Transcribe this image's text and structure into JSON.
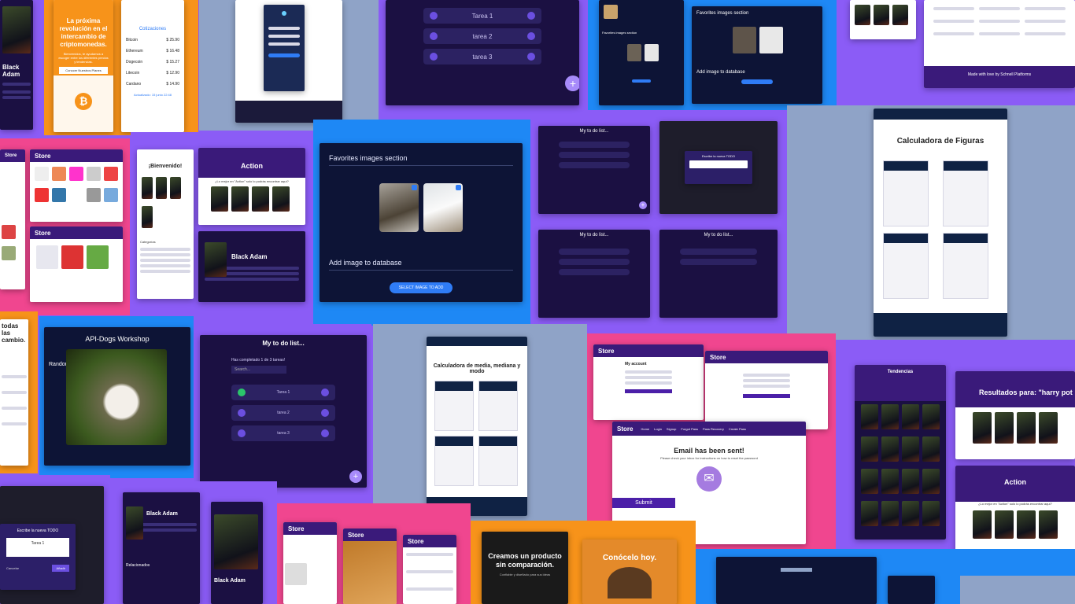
{
  "colors": {
    "purple": "#8b5cf6",
    "blue": "#1e88f5",
    "pink": "#f0468f",
    "orange": "#f7931a",
    "slate": "#8fa3c7"
  },
  "bitcoin": {
    "headline": "La próxima revolución en el intercambio de criptomonedas.",
    "body": "Bienvenidos, te ayudamos a escoger entre los diferentes precios y tendencias.",
    "button": "Conocer Nuestros Planes",
    "icon": "bitcoin-icon"
  },
  "pricing": {
    "title": "Cotizaciones",
    "rows": [
      {
        "label": "Bitcoin",
        "value": "$ 25.90"
      },
      {
        "label": "Ethereum",
        "value": "$ 16.48"
      },
      {
        "label": "Dogecoin",
        "value": "$ 15.27"
      },
      {
        "label": "Litecoin",
        "value": "$ 12.90"
      },
      {
        "label": "Cardano",
        "value": "$ 14.90"
      }
    ],
    "updated": "Actualizado: 15 junio 22:48"
  },
  "movies": {
    "black_adam": "Black Adam",
    "action_title": "Action",
    "action_sub": "¿Lo mejor en \"Action\" solo lo podrás encontrar aquí?",
    "welcome": "¡Bienvenido!",
    "recommended": "Relacionados",
    "categories": "Categorías",
    "search_results": "Resultados para: \"harry pot",
    "trends": "Tendencias"
  },
  "favorites": {
    "title": "Favorites images section",
    "add": "Add image to database",
    "button": "SELECT IMAGE TO ADD"
  },
  "todo": {
    "title": "My to do list...",
    "completed": "Has completado 1 de 3 tareas!",
    "search": "Search...",
    "tasks": [
      "Tarea 1",
      "tarea 2",
      "tarea 3"
    ],
    "new_title": "Escribe la nueva TODO",
    "new_placeholder": "Tarea 1",
    "cancel": "Cancelar",
    "add": "Añadir",
    "fab": "+"
  },
  "dogs": {
    "title": "API-Dogs Workshop",
    "random": "Random"
  },
  "figures": {
    "title": "Calculadora de Figuras"
  },
  "stats": {
    "title": "Calculadora de media, mediana y modo"
  },
  "store": {
    "brand": "Store",
    "account": "My account",
    "email_title": "Email has been sent!",
    "email_body": "Please check your inbox for instructions on how to reset the password",
    "submit": "Submit",
    "nav": [
      "Home",
      "Login",
      "Signup",
      "Forgot Pass",
      "Pass Recovery",
      "Create Pass"
    ]
  },
  "promo": {
    "create": "Creamos un producto sin comparación.",
    "create_sub": "Confiable y diseñado para sus ideas",
    "meet": "Conócelo hoy."
  },
  "misc": {
    "todas": "todas las",
    "cambio": "cambio.",
    "made_with": "Made with love by Schnell Platforms"
  }
}
